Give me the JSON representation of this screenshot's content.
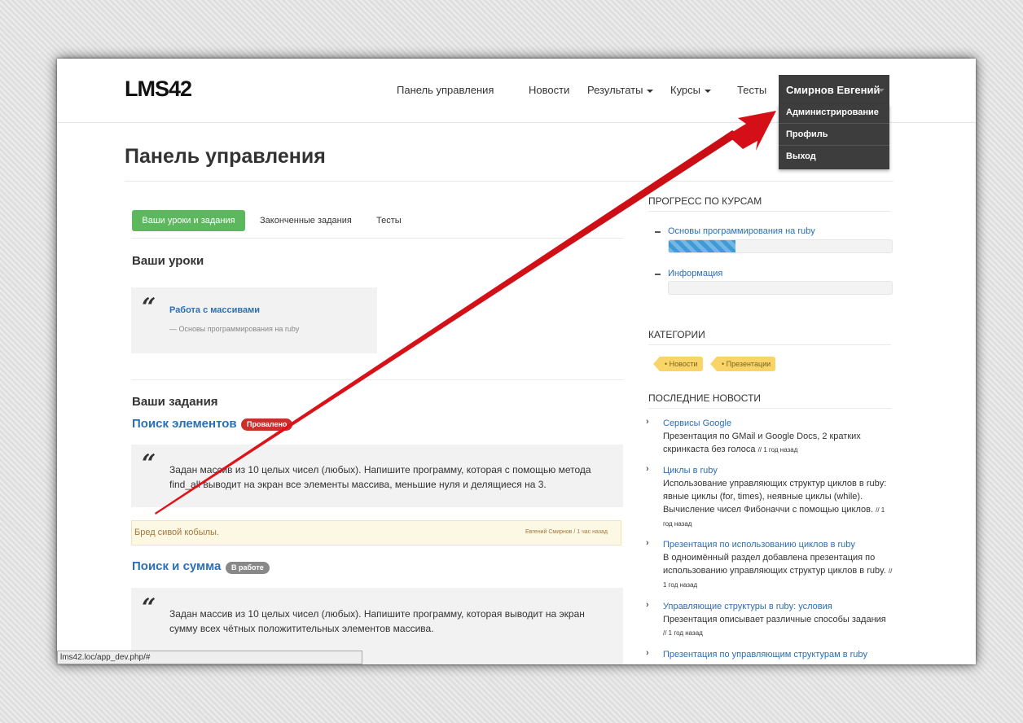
{
  "brand": "LMS42",
  "nav": {
    "dashboard": "Панель управления",
    "news": "Новости",
    "results": "Результаты",
    "courses": "Курсы",
    "tests": "Тесты",
    "user": "Смирнов Евгений"
  },
  "user_menu": {
    "admin": "Администрирование",
    "profile": "Профиль",
    "logout": "Выход"
  },
  "page_title": "Панель управления",
  "tabs": [
    "Ваши уроки и задания",
    "Законченные задания",
    "Тесты"
  ],
  "lessons": {
    "heading": "Ваши уроки",
    "item_title": "Работа с массивами",
    "item_course": "— Основы программирования на ruby"
  },
  "tasks": {
    "heading": "Ваши задания",
    "items": [
      {
        "title": "Поиск элементов",
        "badge": "Провалено",
        "text": "Задан массив из 10 целых чисел (любых). Напишите программу, которая с помощью метода find_all выводит на экран все элементы массива, меньшие нуля и делящиеся на 3.",
        "comment": "Бред сивой кобылы.",
        "comment_meta": "Евгений Смирнов / 1 час назад"
      },
      {
        "title": "Поиск и сумма",
        "badge": "В работе",
        "text": "Задан массив из 10 целых чисел (любых). Напишите программу, которая выводит на экран сумму всех чётных положитительных элементов массива."
      }
    ]
  },
  "sidebar": {
    "progress_heading": "ПРОГРЕСС ПО КУРСАМ",
    "courses": [
      {
        "name": "Основы программирования на ruby",
        "progress_fraction": 0.3
      },
      {
        "name": "Информация",
        "progress_fraction": 0
      }
    ],
    "categories_heading": "КАТЕГОРИИ",
    "categories": [
      "• Новости",
      "• Презентации"
    ],
    "news_heading": "ПОСЛЕДНИЕ НОВОСТИ",
    "news": [
      {
        "title": "Сервисы Google",
        "body": "Презентация по GMail и Google Docs, 2 кратких скринкаста без голоса",
        "time": "// 1 год назад"
      },
      {
        "title": "Циклы в ruby",
        "body": "Использование управляющих структур циклов в ruby: явные циклы (for, times), неявные циклы (while). Вычисление чисел Фибоначчи с помощью циклов.",
        "time": "// 1 год назад"
      },
      {
        "title": "Презентация по использованию циклов в ruby",
        "body": "В одноимённый раздел добавлена презентация по использованию управляющих структур циклов в ruby.",
        "time": "// 1 год назад"
      },
      {
        "title": "Управляющие структуры в ruby: условия",
        "body": "Презентация описывает различные способы задания",
        "time": "// 1 год назад"
      },
      {
        "title": "Презентация по управляющим структурам в ruby",
        "body": "",
        "time": ""
      }
    ]
  },
  "status_bar": "lms42.loc/app_dev.php/#",
  "colors": {
    "accent_green": "#5cb85c",
    "link_blue": "#2a6fb5",
    "badge_failed": "#c9302c",
    "badge_in_progress": "#888888",
    "tag_yellow": "#f8d469",
    "annotation_arrow": "#e0141b"
  },
  "icons": [
    "quote-icon",
    "chevron-right-icon",
    "minus-icon",
    "caret-down-icon"
  ]
}
